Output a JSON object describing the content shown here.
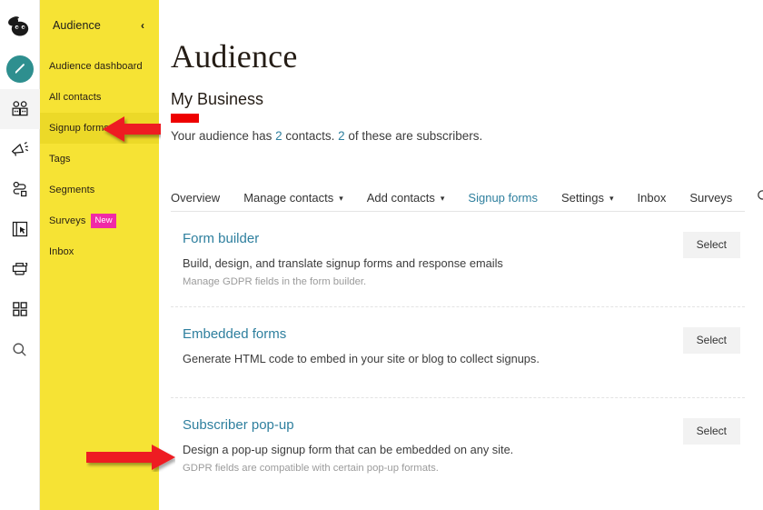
{
  "icon_rail": {
    "items": [
      {
        "name": "mailchimp-logo",
        "selected": false
      },
      {
        "name": "campaigns-pencil-icon",
        "selected": false
      },
      {
        "name": "audience-contacts-icon",
        "selected": true
      },
      {
        "name": "campaigns-megaphone-icon",
        "selected": false
      },
      {
        "name": "automations-icon",
        "selected": false
      },
      {
        "name": "website-icon",
        "selected": false
      },
      {
        "name": "content-studio-icon",
        "selected": false
      },
      {
        "name": "integrations-grid-icon",
        "selected": false
      },
      {
        "name": "search-icon",
        "selected": false
      }
    ]
  },
  "sidebar": {
    "title": "Audience",
    "collapse_icon": "‹",
    "items": [
      {
        "label": "Audience dashboard",
        "active": false,
        "badge": ""
      },
      {
        "label": "All contacts",
        "active": false,
        "badge": ""
      },
      {
        "label": "Signup forms",
        "active": true,
        "badge": ""
      },
      {
        "label": "Tags",
        "active": false,
        "badge": ""
      },
      {
        "label": "Segments",
        "active": false,
        "badge": ""
      },
      {
        "label": "Surveys",
        "active": false,
        "badge": "New"
      },
      {
        "label": "Inbox",
        "active": false,
        "badge": ""
      }
    ]
  },
  "main": {
    "page_title": "Audience",
    "audience_name": "My Business",
    "stats": {
      "prefix": "Your audience has ",
      "contacts_count": "2",
      "middle": " contacts. ",
      "subscribers_count": "2",
      "suffix": " of these are subscribers."
    },
    "tabs": [
      {
        "label": "Overview",
        "caret": false,
        "active": false
      },
      {
        "label": "Manage contacts",
        "caret": true,
        "active": false
      },
      {
        "label": "Add contacts",
        "caret": true,
        "active": false
      },
      {
        "label": "Signup forms",
        "caret": false,
        "active": true
      },
      {
        "label": "Settings",
        "caret": true,
        "active": false
      },
      {
        "label": "Inbox",
        "caret": false,
        "active": false
      },
      {
        "label": "Surveys",
        "caret": false,
        "active": false
      }
    ],
    "tab_search_icon": "search-icon",
    "forms": [
      {
        "title": "Form builder",
        "description": "Build, design, and translate signup forms and response emails",
        "note": "Manage GDPR fields in the form builder.",
        "button": "Select"
      },
      {
        "title": "Embedded forms",
        "description": "Generate HTML code to embed in your site or blog to collect signups.",
        "note": "",
        "button": "Select"
      },
      {
        "title": "Subscriber pop-up",
        "description": "Design a pop-up signup form that can be embedded on any site.",
        "note": "GDPR fields are compatible with certain pop-up formats.",
        "button": "Select"
      }
    ]
  },
  "annotations": {
    "arrow_color": "#ee1c23",
    "redaction_color": "#ee0000",
    "arrows": [
      {
        "name": "arrow-pointing-signup-forms",
        "direction": "left"
      },
      {
        "name": "arrow-pointing-subscriber-popup",
        "direction": "right"
      }
    ]
  },
  "colors": {
    "sidebar_yellow": "#f6e334",
    "sidebar_active_yellow": "#ecd928",
    "link_teal": "#2e7f9e",
    "badge_pink": "#f02aa6"
  }
}
